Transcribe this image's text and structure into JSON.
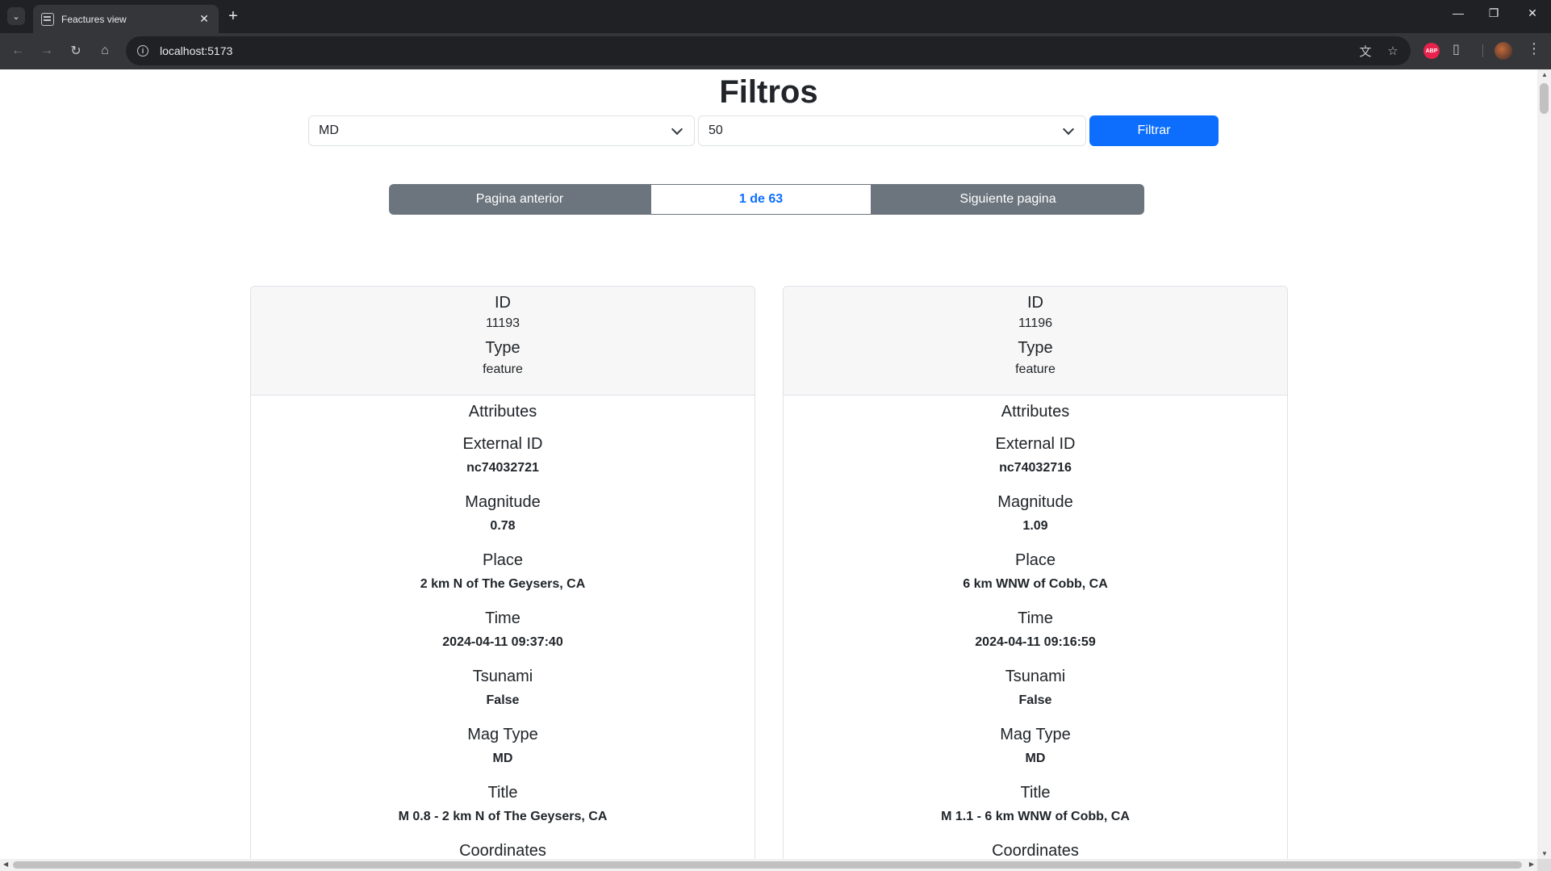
{
  "browser": {
    "tab_title": "Feactures view",
    "url": "localhost:5173",
    "abp_label": "ABP"
  },
  "page": {
    "title": "Filtros",
    "filters": {
      "magtype_value": "MD",
      "perpage_value": "50",
      "filter_button": "Filtrar"
    },
    "pagination": {
      "prev_label": "Pagina anterior",
      "current_label": "1 de 63",
      "next_label": "Siguiente pagina"
    },
    "labels": {
      "id": "ID",
      "type": "Type",
      "attributes": "Attributes",
      "external_id": "External ID",
      "magnitude": "Magnitude",
      "place": "Place",
      "time": "Time",
      "tsunami": "Tsunami",
      "mag_type": "Mag Type",
      "title": "Title",
      "coordinates": "Coordinates"
    },
    "features": [
      {
        "id": "11193",
        "type": "feature",
        "external_id": "nc74032721",
        "magnitude": "0.78",
        "place": "2 km N of The Geysers, CA",
        "time": "2024-04-11 09:37:40",
        "tsunami": "False",
        "mag_type": "MD",
        "title": "M 0.8 - 2 km N of The Geysers, CA"
      },
      {
        "id": "11196",
        "type": "feature",
        "external_id": "nc74032716",
        "magnitude": "1.09",
        "place": "6 km WNW of Cobb, CA",
        "time": "2024-04-11 09:16:59",
        "tsunami": "False",
        "mag_type": "MD",
        "title": "M 1.1 - 6 km WNW of Cobb, CA"
      }
    ]
  }
}
